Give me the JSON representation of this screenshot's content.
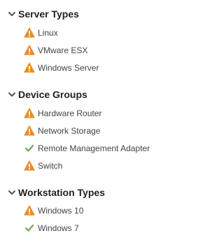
{
  "groups": [
    {
      "title": "Server Types",
      "items": [
        {
          "label": "Linux",
          "status": "warning"
        },
        {
          "label": "VMware ESX",
          "status": "warning"
        },
        {
          "label": "Windows Server",
          "status": "warning"
        }
      ]
    },
    {
      "title": "Device Groups",
      "items": [
        {
          "label": "Hardware Router",
          "status": "warning"
        },
        {
          "label": "Network Storage",
          "status": "warning"
        },
        {
          "label": "Remote Management Adapter",
          "status": "ok"
        },
        {
          "label": "Switch",
          "status": "warning"
        }
      ]
    },
    {
      "title": "Workstation Types",
      "items": [
        {
          "label": "Windows 10",
          "status": "warning"
        },
        {
          "label": "Windows 7",
          "status": "ok"
        }
      ]
    }
  ],
  "colors": {
    "warning": "#f08a24",
    "ok": "#6aa84f",
    "chevron": "#555555"
  },
  "icons": {
    "group_toggle": "chevron-down-icon",
    "warning": "warning-triangle-icon",
    "ok": "checkmark-icon"
  }
}
